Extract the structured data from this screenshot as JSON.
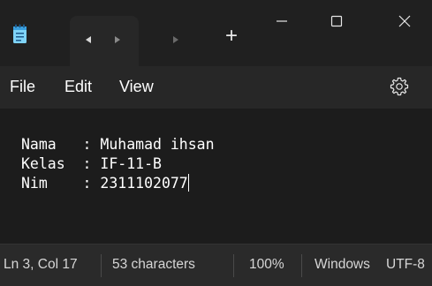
{
  "window": {
    "controls": {
      "minimize": "minimize-icon",
      "maximize": "maximize-icon",
      "close": "close-icon"
    },
    "new_tab_label": "+"
  },
  "menu": {
    "file": "File",
    "edit": "Edit",
    "view": "View"
  },
  "editor": {
    "lines": [
      "Nama   : Muhamad ihsan",
      "Kelas  : IF-11-B",
      "Nim    : 2311102077"
    ]
  },
  "status": {
    "position": "Ln 3, Col 17",
    "characters": "53 characters",
    "zoom": "100%",
    "line_ending": "Windows (CRLF)",
    "encoding": "UTF-8"
  },
  "colors": {
    "titlebar": "#202020",
    "menubar": "#272727",
    "editor": "#1c1c1c",
    "statusbar": "#2a2a2a",
    "text": "#ffffff"
  }
}
